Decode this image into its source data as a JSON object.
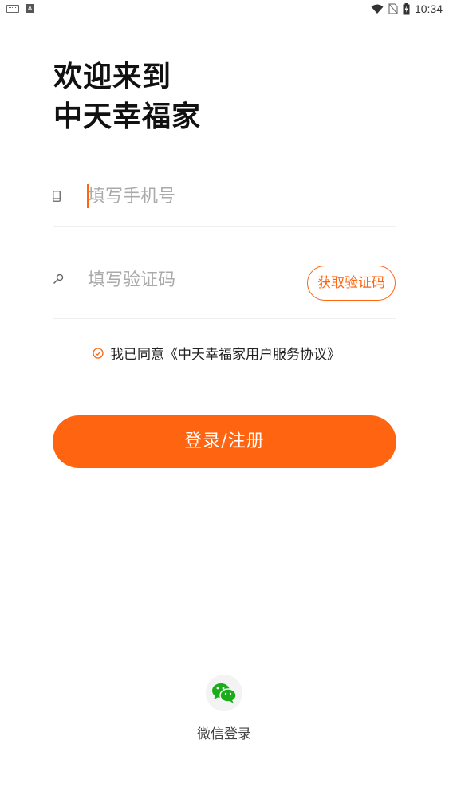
{
  "status_bar": {
    "time": "10:34",
    "left_icons": [
      "keyboard-icon",
      "a-notification-icon"
    ],
    "right_icons": [
      "wifi-icon",
      "no-sim-icon",
      "battery-charging-icon"
    ]
  },
  "welcome": {
    "line1": "欢迎来到",
    "line2": "中天幸福家"
  },
  "phone_field": {
    "icon": "phone-icon",
    "placeholder": "填写手机号",
    "value": ""
  },
  "code_field": {
    "icon": "key-icon",
    "placeholder": "填写验证码",
    "value": "",
    "get_code_label": "获取验证码"
  },
  "agreement": {
    "text": "我已同意《中天幸福家用户服务协议》",
    "checked": true
  },
  "login_button": {
    "label": "登录/注册"
  },
  "wechat_login": {
    "label": "微信登录",
    "icon": "wechat-icon"
  },
  "colors": {
    "accent": "#ff6410",
    "wechat_green": "#1aad19",
    "placeholder": "#aaaaaa"
  }
}
